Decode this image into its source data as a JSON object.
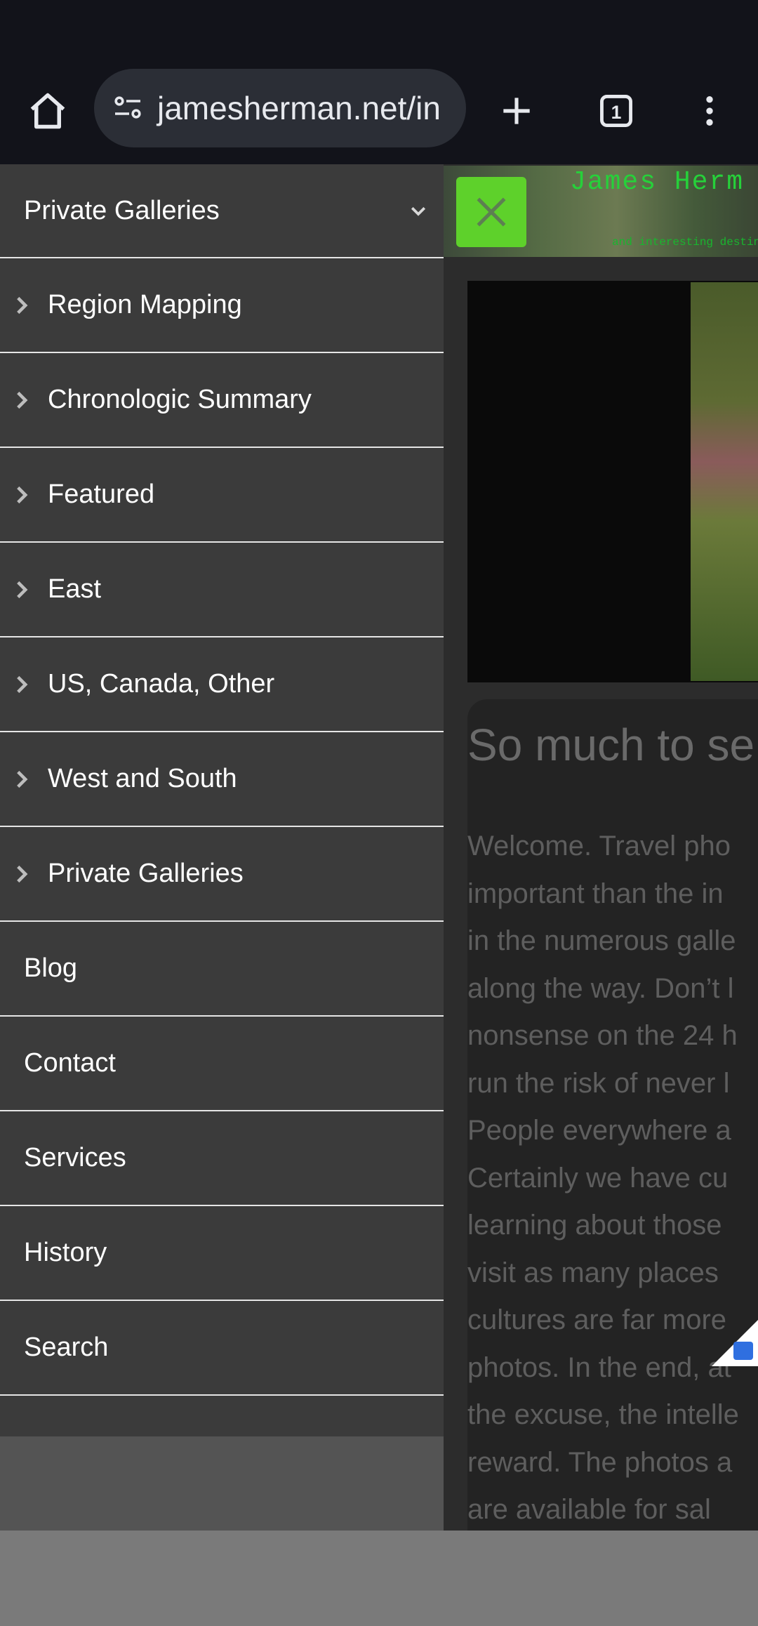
{
  "browser": {
    "url": "jamesherman.net/in",
    "tab_count": "1"
  },
  "banner": {
    "title": "James Herm",
    "tagline": "and interesting destin"
  },
  "content": {
    "title": "So much to se",
    "paragraph_lines": [
      "Welcome. Travel pho",
      "important than the in",
      "in the numerous galle",
      "along the way. Don’t l",
      "nonsense on the 24 h",
      "run the risk of never l",
      "People everywhere a",
      "Certainly we have cu",
      "learning about those",
      "visit as many places",
      "cultures are far more",
      "photos. In the end, at",
      "the excuse, the intelle",
      "reward. The photos a",
      "are available for sal"
    ]
  },
  "sidebar": {
    "header_label": "Private Galleries",
    "items": [
      {
        "label": "Region Mapping",
        "expandable": true
      },
      {
        "label": "Chronologic Summary",
        "expandable": true
      },
      {
        "label": "Featured",
        "expandable": true
      },
      {
        "label": "East",
        "expandable": true
      },
      {
        "label": "US, Canada, Other",
        "expandable": true
      },
      {
        "label": "West and South",
        "expandable": true
      },
      {
        "label": "Private Galleries",
        "expandable": true
      },
      {
        "label": "Blog",
        "expandable": false
      },
      {
        "label": "Contact",
        "expandable": false
      },
      {
        "label": "Services",
        "expandable": false
      },
      {
        "label": "History",
        "expandable": false
      },
      {
        "label": "Search",
        "expandable": false
      }
    ]
  },
  "colors": {
    "close_button": "#5ed12b",
    "sidebar_bg": "#3b3b3b",
    "toolbar_bg": "#12131a"
  },
  "icons": [
    "home-icon",
    "site-settings-icon",
    "new-tab-icon",
    "tab-switcher-icon",
    "more-options-icon",
    "close-icon",
    "chevron-right-icon",
    "chevron-down-icon",
    "shopping-bag-icon"
  ]
}
